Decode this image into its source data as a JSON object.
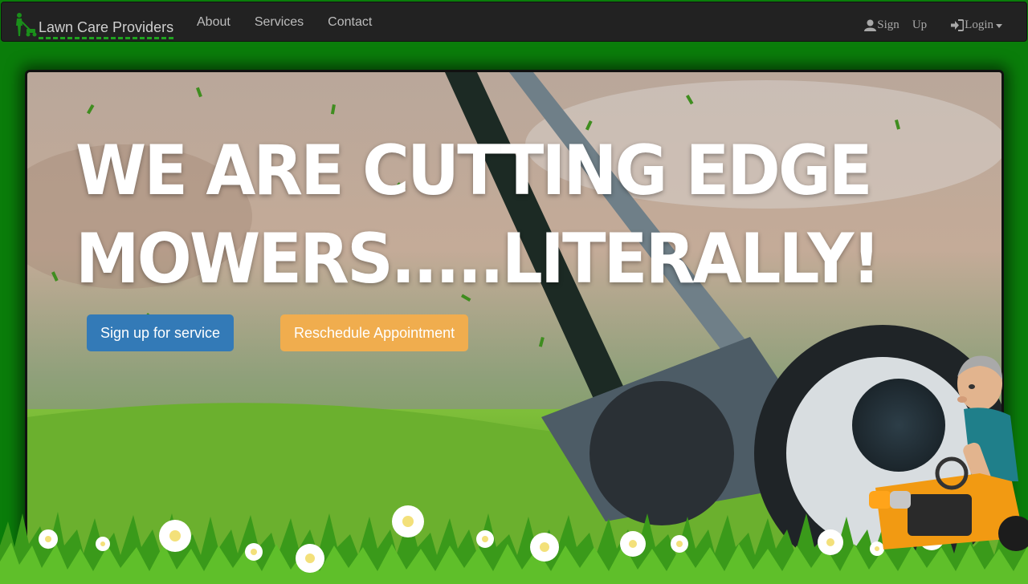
{
  "navbar": {
    "brand": "Lawn Care Providers",
    "links": [
      "About",
      "Services",
      "Contact"
    ],
    "signup": {
      "word1": "Sign",
      "word2": "Up"
    },
    "login": "Login"
  },
  "hero": {
    "headline_line1": "WE ARE CUTTING EDGE",
    "headline_line2": "MOWERS.....LITERALLY!",
    "primary_button": "Sign up for service",
    "secondary_button": "Reschedule Appointment"
  },
  "icons": {
    "brand": "lawnmower-person-icon",
    "signup": "user-icon",
    "login": "login-icon",
    "dropdown": "caret-down-icon"
  },
  "colors": {
    "page_bg": "#0a7d0a",
    "navbar_bg": "#222222",
    "primary": "#337ab7",
    "warning": "#f0ad4e",
    "brand_underline": "#1fa31f"
  }
}
